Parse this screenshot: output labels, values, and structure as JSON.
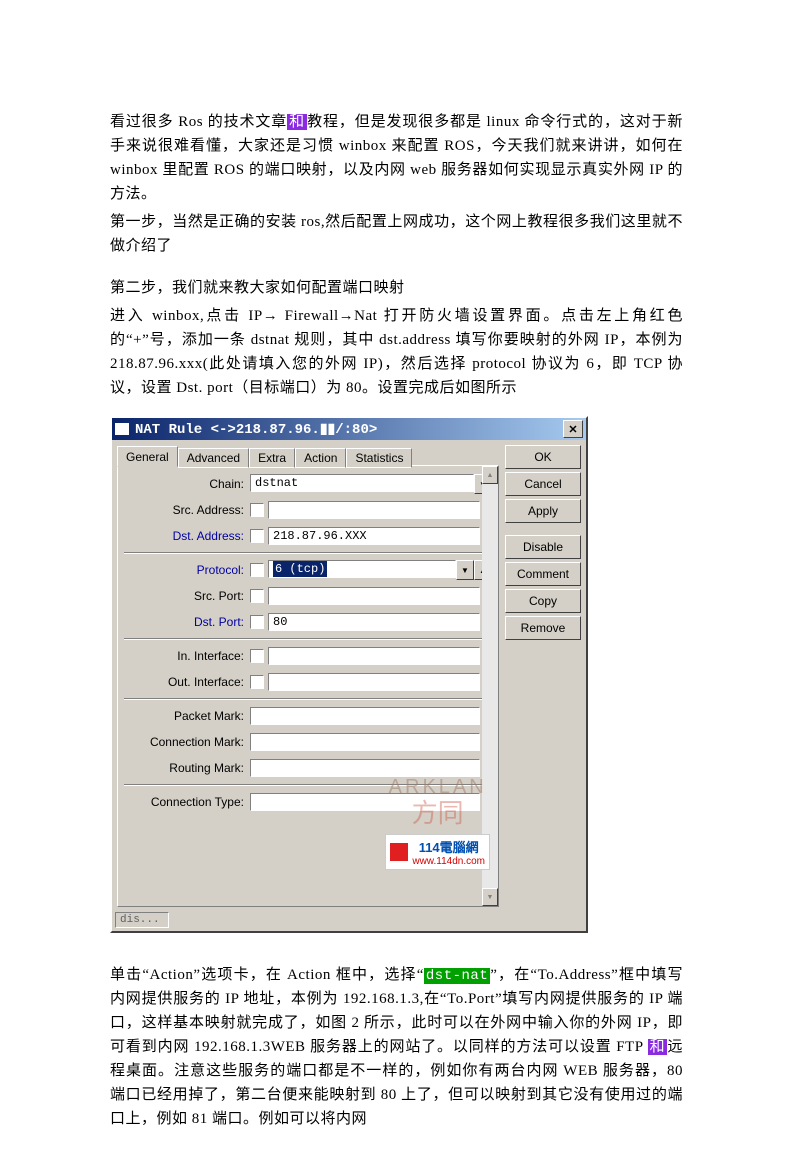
{
  "paras": {
    "p1a": "看过很多 Ros 的技术文章",
    "p1_hl": "和",
    "p1b": "教程，但是发现很多都是 linux 命令行式的，这对于新手来说很难看懂，大家还是习惯 winbox 来配置 ROS，今天我们就来讲讲，如何在 winbox 里配置 ROS 的端口映射，以及内网 web 服务器如何实现显示真实外网 IP 的方法。",
    "p2": "第一步，当然是正确的安装 ros,然后配置上网成功，这个网上教程很多我们这里就不做介绍了",
    "p3": "第二步，我们就来教大家如何配置端口映射",
    "p4": "进入 winbox,点击 IP→ Firewall→Nat 打开防火墙设置界面。点击左上角红色的“+”号，添加一条 dstnat 规则，其中 dst.address 填写你要映射的外网 IP，本例为 218.87.96.xxx(此处请填入您的外网 IP)，然后选择 protocol 协议为 6，即 TCP 协议，设置 Dst. port（目标端口）为 80。设置完成后如图所示",
    "p5a": "单击“Action”选项卡，在 Action 框中，选择“",
    "p5_hl": "dst-nat",
    "p5b": "”，在“To.Address”框中填写内网提供服务的 IP 地址，本例为 192.168.1.3,在“To.Port”填写内网提供服务的 IP 端口，这样基本映射就完成了，如图 2 所示，此时可以在外网中输入你的外网 IP，即可看到内网 192.168.1.3WEB 服务器上的网站了。以同样的方法可以设置 FTP ",
    "p5_hl2": "和",
    "p5c": "远程桌面。注意这些服务的端口都是不一样的，例如你有两台内网 WEB 服务器，80 端口已经用掉了，第二台便来能映射到 80 上了，但可以映射到其它没有使用过的端口上，例如 81 端口。例如可以将内网"
  },
  "dialog": {
    "title": "NAT Rule <->218.87.96.▮▮/:80>",
    "close": "✕",
    "tabs": [
      "General",
      "Advanced",
      "Extra",
      "Action",
      "Statistics"
    ],
    "buttons": [
      "OK",
      "Cancel",
      "Apply",
      "Disable",
      "Comment",
      "Copy",
      "Remove"
    ],
    "status": "dis...",
    "fields": {
      "chain_label": "Chain:",
      "chain_value": "dstnat",
      "src_addr_label": "Src. Address:",
      "src_addr_value": "",
      "dst_addr_label": "Dst. Address:",
      "dst_addr_value": "218.87.96.XXX",
      "protocol_label": "Protocol:",
      "protocol_value": "6 (tcp)",
      "src_port_label": "Src. Port:",
      "src_port_value": "",
      "dst_port_label": "Dst. Port:",
      "dst_port_value": "80",
      "in_if_label": "In. Interface:",
      "out_if_label": "Out. Interface:",
      "pkt_mark_label": "Packet Mark:",
      "conn_mark_label": "Connection Mark:",
      "route_mark_label": "Routing Mark:",
      "conn_type_label": "Connection Type:"
    }
  },
  "watermark": {
    "faint1": "ARKLAN",
    "faint2": "方同",
    "logo1": "114電腦網",
    "logo2": "www.114dn.com"
  }
}
